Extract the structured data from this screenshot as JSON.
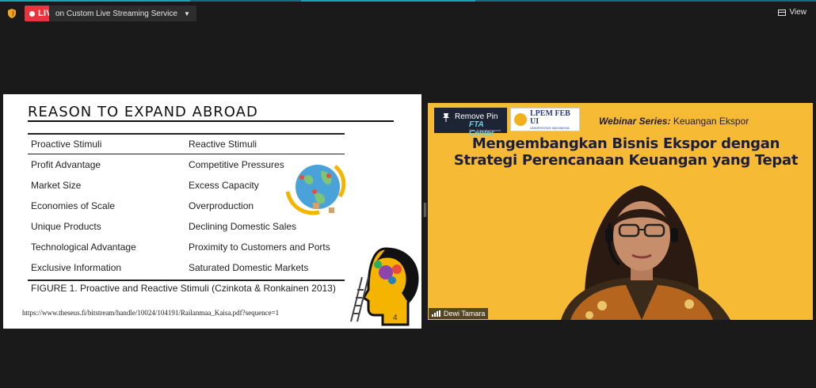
{
  "topbar": {
    "live_label": "LIVE",
    "service_label": "on Custom Live Streaming Service",
    "view_label": "View"
  },
  "slide": {
    "title": "REASON TO EXPAND ABROAD",
    "table": {
      "headers": [
        "Proactive Stimuli",
        "Reactive Stimuli"
      ],
      "rows": [
        [
          "Profit Advantage",
          "Competitive Pressures"
        ],
        [
          "Market Size",
          "Excess Capacity"
        ],
        [
          "Economies of Scale",
          "Overproduction"
        ],
        [
          "Unique Products",
          "Declining Domestic Sales"
        ],
        [
          "Technological Advantage",
          "Proximity to Customers and Ports"
        ],
        [
          "Exclusive Information",
          "Saturated Domestic Markets"
        ]
      ]
    },
    "caption": "FIGURE 1. Proactive and Reactive Stimuli (Czinkota & Ronkainen 2013)",
    "url": "https://www.theseus.fi/bitstream/handle/10024/104191/Railanmaa_Kaisa.pdf?sequence=1",
    "page_number": "4"
  },
  "video": {
    "pin_label": "Remove Pin",
    "fta_label": "FTA Center",
    "fta_sub": "Free Trade Agreement",
    "lpem_label": "LPEM FEB UI",
    "lpem_sub": "UNIVERSITAS INDONESIA",
    "series_bold": "Webinar Series:",
    "series_rest": " Keuangan Ekspor",
    "headline_1": "Mengembangkan Bisnis Ekspor dengan",
    "headline_2": "Strategi Perencanaan Keuangan yang Tepat",
    "participant_name": "Dewi Tamara"
  },
  "colors": {
    "live_red": "#e8343a",
    "video_bg": "#f7ba35",
    "headline": "#1b1f3f",
    "window_bg": "#1a1a1a"
  },
  "icons": [
    "shield-icon",
    "live-dot-icon",
    "chevron-down-icon",
    "view-icon",
    "pin-icon",
    "signal-bars-icon"
  ]
}
